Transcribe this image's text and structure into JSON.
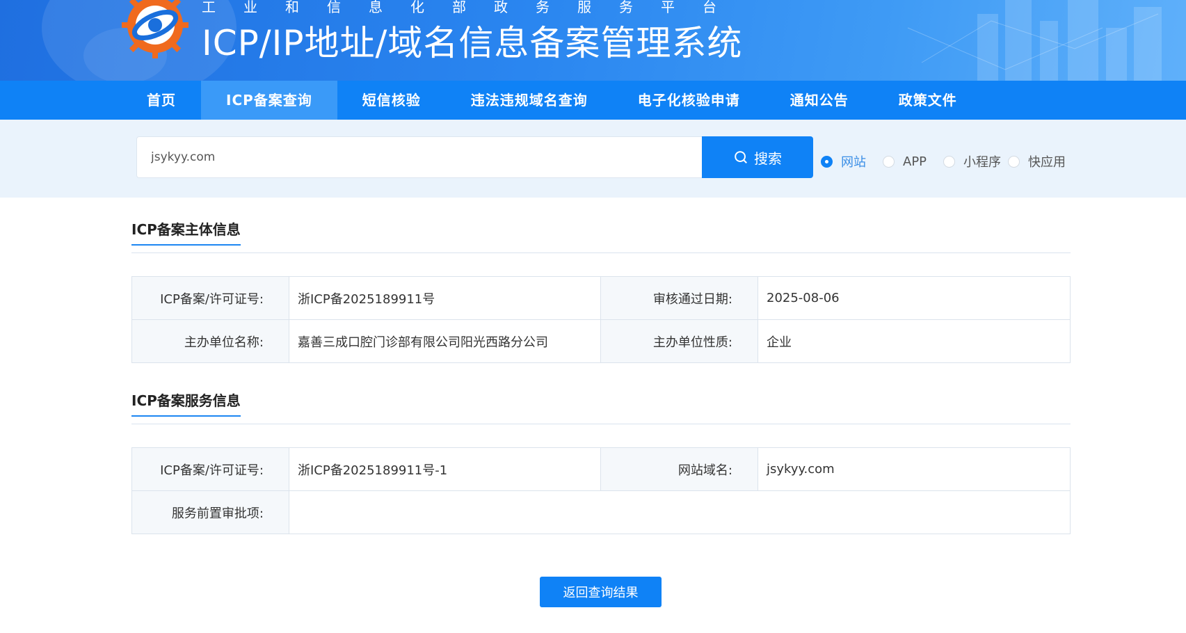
{
  "header": {
    "subtitle": "工业和信息化部政务服务平台",
    "title": "ICP/IP地址/域名信息备案管理系统",
    "colors": {
      "primary": "#0f82f6",
      "nav_active": "#3a9af8",
      "logo_orange": "#f06a1e"
    }
  },
  "nav": {
    "items": [
      {
        "label": "首页"
      },
      {
        "label": "ICP备案查询",
        "active": true
      },
      {
        "label": "短信核验"
      },
      {
        "label": "违法违规域名查询"
      },
      {
        "label": "电子化核验申请"
      },
      {
        "label": "通知公告"
      },
      {
        "label": "政策文件"
      }
    ]
  },
  "search": {
    "value": "jsykyy.com",
    "button_label": "搜索",
    "button_icon": "search-icon",
    "types": [
      {
        "label": "网站",
        "checked": true
      },
      {
        "label": "APP",
        "checked": false
      },
      {
        "label": "小程序",
        "checked": false
      },
      {
        "label": "快应用",
        "checked": false
      }
    ]
  },
  "subject_info": {
    "title": "ICP备案主体信息",
    "rows": [
      {
        "label1": "ICP备案/许可证号:",
        "value1": "浙ICP备2025189911号",
        "label2": "审核通过日期:",
        "value2": "2025-08-06"
      },
      {
        "label1": "主办单位名称:",
        "value1": "嘉善三成口腔门诊部有限公司阳光西路分公司",
        "label2": "主办单位性质:",
        "value2": "企业"
      }
    ]
  },
  "service_info": {
    "title": "ICP备案服务信息",
    "row1": {
      "label1": "ICP备案/许可证号:",
      "value1": "浙ICP备2025189911号-1",
      "label2": "网站域名:",
      "value2": "jsykyy.com"
    },
    "row2": {
      "label": "服务前置审批项:",
      "value": ""
    }
  },
  "back_button": "返回查询结果"
}
